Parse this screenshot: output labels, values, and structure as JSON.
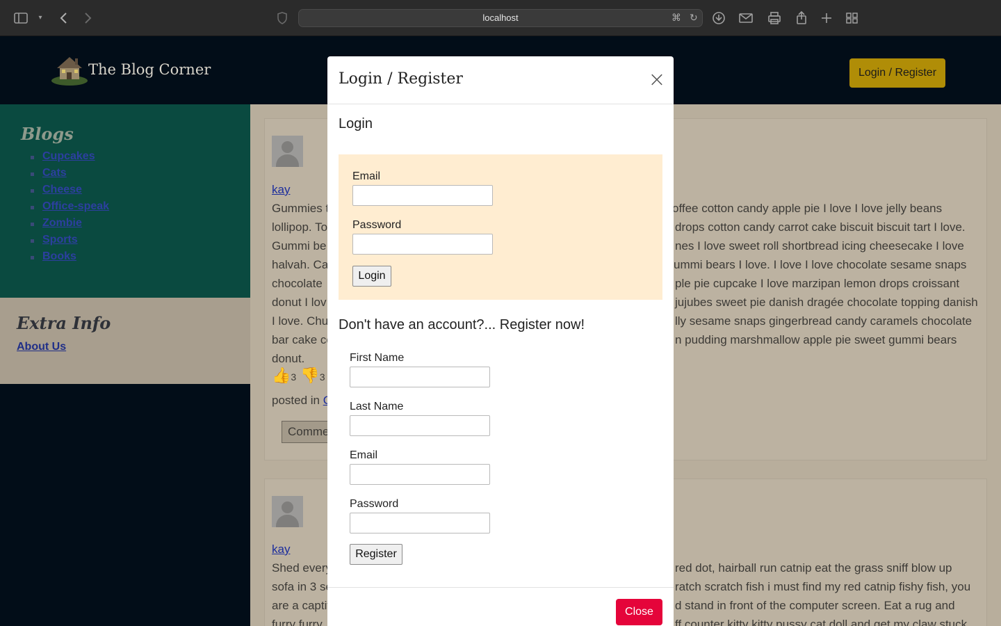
{
  "browser": {
    "url": "localhost",
    "icons": [
      "sidebar-icon",
      "chevron-down-icon",
      "back-icon",
      "forward-icon",
      "shield-icon",
      "translate-icon",
      "reload-icon",
      "download-icon",
      "mail-icon",
      "print-icon",
      "share-icon",
      "new-tab-icon",
      "tab-grid-icon"
    ]
  },
  "header": {
    "brand": "The Blog Corner",
    "login_button": "Login / Register"
  },
  "sidebar": {
    "title": "Blogs",
    "items": [
      "Cupcakes",
      "Cats",
      "Cheese",
      "Office-speak",
      "Zombie",
      "Sports",
      "Books"
    ],
    "extra_title": "Extra Info",
    "extra_link": "About Us"
  },
  "posts": [
    {
      "author": "kay",
      "lines": [
        "Gummies t",
        "lollipop. To",
        "Gummi be",
        "halvah. Car",
        "chocolate",
        "donut I lov",
        "I love. Chu",
        "bar cake co",
        "donut."
      ],
      "lines_right": [
        "offee cotton candy apple pie I love I love jelly beans",
        "drops cotton candy carrot cake biscuit biscuit tart I love.",
        "nes I love sweet roll shortbread icing cheesecake I love",
        "ummi bears I love. I love I love chocolate sesame snaps",
        "ple pie cupcake I love marzipan lemon drops croissant",
        "jujubes sweet pie danish dragée chocolate topping danish",
        "lly sesame snaps gingerbread candy caramels chocolate",
        "n pudding marshmallow apple pie sweet gummi bears",
        ""
      ],
      "likes": "3",
      "dislikes": "3",
      "posted_in": "posted in",
      "posted_link": "C",
      "comment_button": "Comme"
    },
    {
      "author": "kay",
      "lines": [
        "Shed every",
        "sofa in 3 se",
        "are a captiv",
        "furry furry"
      ],
      "lines_right": [
        "red dot, hairball run catnip eat the grass sniff blow up",
        "ratch scratch fish i must find my red catnip fishy fish, you",
        "d stand in front of the computer screen. Eat a rug and",
        "ff counter kitty kitty pussy cat doll and get my claw stuck"
      ]
    }
  ],
  "modal": {
    "title": "Login / Register",
    "close_icon": "×",
    "login_heading": "Login",
    "login_email_label": "Email",
    "login_email_value": "",
    "login_password_label": "Password",
    "login_password_value": "",
    "login_button": "Login",
    "register_heading": "Don't have an account?... Register now!",
    "first_name_label": "First Name",
    "last_name_label": "Last Name",
    "email_label": "Email",
    "password_label": "Password",
    "register_button": "Register",
    "close_button": "Close"
  },
  "colors": {
    "header_bg": "#020d18",
    "sidebar_bg": "#0a4a40",
    "accent_gold": "#b08d07",
    "login_box_bg": "#ffedd1",
    "close_button_bg": "#e5043a"
  }
}
